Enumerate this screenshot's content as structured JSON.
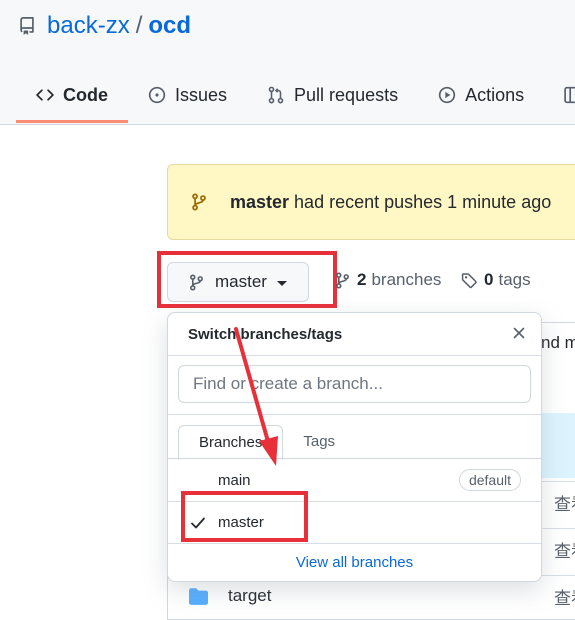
{
  "repo": {
    "owner": "back-zx",
    "separator": "/",
    "name": "ocd"
  },
  "tabs": [
    {
      "label": "Code",
      "icon": "code-icon",
      "selected": true
    },
    {
      "label": "Issues",
      "icon": "issue-opened-icon"
    },
    {
      "label": "Pull requests",
      "icon": "git-pull-request-icon"
    },
    {
      "label": "Actions",
      "icon": "play-icon"
    }
  ],
  "banner": {
    "branch": "master",
    "message": "had recent pushes 1 minute ago"
  },
  "branch_button": {
    "label": "master"
  },
  "meta": {
    "branches_count": "2",
    "branches_label": "branches",
    "tags_count": "0",
    "tags_label": "tags"
  },
  "dropdown": {
    "title": "Switch branches/tags",
    "placeholder": "Find or create a branch...",
    "tabs": [
      "Branches",
      "Tags"
    ],
    "items": [
      {
        "name": "main",
        "badge": "default"
      },
      {
        "name": "master",
        "checked": true
      }
    ],
    "footer": "View all branches"
  },
  "background_partial": {
    "commit_fragment": "nd m",
    "chinese_fragment": "查看",
    "file_name": "target"
  },
  "colors": {
    "annotation_red": "#e8303a",
    "link_blue": "#0969da",
    "banner_yellow": "#fff8c5"
  }
}
